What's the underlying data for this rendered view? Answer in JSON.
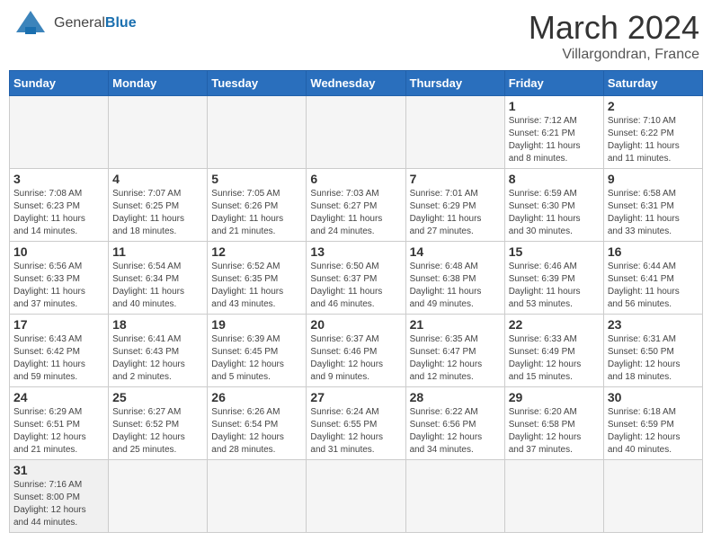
{
  "header": {
    "logo_general": "General",
    "logo_blue": "Blue",
    "month_title": "March 2024",
    "location": "Villargondran, France"
  },
  "weekdays": [
    "Sunday",
    "Monday",
    "Tuesday",
    "Wednesday",
    "Thursday",
    "Friday",
    "Saturday"
  ],
  "weeks": [
    [
      {
        "day": "",
        "info": ""
      },
      {
        "day": "",
        "info": ""
      },
      {
        "day": "",
        "info": ""
      },
      {
        "day": "",
        "info": ""
      },
      {
        "day": "",
        "info": ""
      },
      {
        "day": "1",
        "info": "Sunrise: 7:12 AM\nSunset: 6:21 PM\nDaylight: 11 hours\nand 8 minutes."
      },
      {
        "day": "2",
        "info": "Sunrise: 7:10 AM\nSunset: 6:22 PM\nDaylight: 11 hours\nand 11 minutes."
      }
    ],
    [
      {
        "day": "3",
        "info": "Sunrise: 7:08 AM\nSunset: 6:23 PM\nDaylight: 11 hours\nand 14 minutes."
      },
      {
        "day": "4",
        "info": "Sunrise: 7:07 AM\nSunset: 6:25 PM\nDaylight: 11 hours\nand 18 minutes."
      },
      {
        "day": "5",
        "info": "Sunrise: 7:05 AM\nSunset: 6:26 PM\nDaylight: 11 hours\nand 21 minutes."
      },
      {
        "day": "6",
        "info": "Sunrise: 7:03 AM\nSunset: 6:27 PM\nDaylight: 11 hours\nand 24 minutes."
      },
      {
        "day": "7",
        "info": "Sunrise: 7:01 AM\nSunset: 6:29 PM\nDaylight: 11 hours\nand 27 minutes."
      },
      {
        "day": "8",
        "info": "Sunrise: 6:59 AM\nSunset: 6:30 PM\nDaylight: 11 hours\nand 30 minutes."
      },
      {
        "day": "9",
        "info": "Sunrise: 6:58 AM\nSunset: 6:31 PM\nDaylight: 11 hours\nand 33 minutes."
      }
    ],
    [
      {
        "day": "10",
        "info": "Sunrise: 6:56 AM\nSunset: 6:33 PM\nDaylight: 11 hours\nand 37 minutes."
      },
      {
        "day": "11",
        "info": "Sunrise: 6:54 AM\nSunset: 6:34 PM\nDaylight: 11 hours\nand 40 minutes."
      },
      {
        "day": "12",
        "info": "Sunrise: 6:52 AM\nSunset: 6:35 PM\nDaylight: 11 hours\nand 43 minutes."
      },
      {
        "day": "13",
        "info": "Sunrise: 6:50 AM\nSunset: 6:37 PM\nDaylight: 11 hours\nand 46 minutes."
      },
      {
        "day": "14",
        "info": "Sunrise: 6:48 AM\nSunset: 6:38 PM\nDaylight: 11 hours\nand 49 minutes."
      },
      {
        "day": "15",
        "info": "Sunrise: 6:46 AM\nSunset: 6:39 PM\nDaylight: 11 hours\nand 53 minutes."
      },
      {
        "day": "16",
        "info": "Sunrise: 6:44 AM\nSunset: 6:41 PM\nDaylight: 11 hours\nand 56 minutes."
      }
    ],
    [
      {
        "day": "17",
        "info": "Sunrise: 6:43 AM\nSunset: 6:42 PM\nDaylight: 11 hours\nand 59 minutes."
      },
      {
        "day": "18",
        "info": "Sunrise: 6:41 AM\nSunset: 6:43 PM\nDaylight: 12 hours\nand 2 minutes."
      },
      {
        "day": "19",
        "info": "Sunrise: 6:39 AM\nSunset: 6:45 PM\nDaylight: 12 hours\nand 5 minutes."
      },
      {
        "day": "20",
        "info": "Sunrise: 6:37 AM\nSunset: 6:46 PM\nDaylight: 12 hours\nand 9 minutes."
      },
      {
        "day": "21",
        "info": "Sunrise: 6:35 AM\nSunset: 6:47 PM\nDaylight: 12 hours\nand 12 minutes."
      },
      {
        "day": "22",
        "info": "Sunrise: 6:33 AM\nSunset: 6:49 PM\nDaylight: 12 hours\nand 15 minutes."
      },
      {
        "day": "23",
        "info": "Sunrise: 6:31 AM\nSunset: 6:50 PM\nDaylight: 12 hours\nand 18 minutes."
      }
    ],
    [
      {
        "day": "24",
        "info": "Sunrise: 6:29 AM\nSunset: 6:51 PM\nDaylight: 12 hours\nand 21 minutes."
      },
      {
        "day": "25",
        "info": "Sunrise: 6:27 AM\nSunset: 6:52 PM\nDaylight: 12 hours\nand 25 minutes."
      },
      {
        "day": "26",
        "info": "Sunrise: 6:26 AM\nSunset: 6:54 PM\nDaylight: 12 hours\nand 28 minutes."
      },
      {
        "day": "27",
        "info": "Sunrise: 6:24 AM\nSunset: 6:55 PM\nDaylight: 12 hours\nand 31 minutes."
      },
      {
        "day": "28",
        "info": "Sunrise: 6:22 AM\nSunset: 6:56 PM\nDaylight: 12 hours\nand 34 minutes."
      },
      {
        "day": "29",
        "info": "Sunrise: 6:20 AM\nSunset: 6:58 PM\nDaylight: 12 hours\nand 37 minutes."
      },
      {
        "day": "30",
        "info": "Sunrise: 6:18 AM\nSunset: 6:59 PM\nDaylight: 12 hours\nand 40 minutes."
      }
    ],
    [
      {
        "day": "31",
        "info": "Sunrise: 7:16 AM\nSunset: 8:00 PM\nDaylight: 12 hours\nand 44 minutes."
      },
      {
        "day": "",
        "info": ""
      },
      {
        "day": "",
        "info": ""
      },
      {
        "day": "",
        "info": ""
      },
      {
        "day": "",
        "info": ""
      },
      {
        "day": "",
        "info": ""
      },
      {
        "day": "",
        "info": ""
      }
    ]
  ]
}
